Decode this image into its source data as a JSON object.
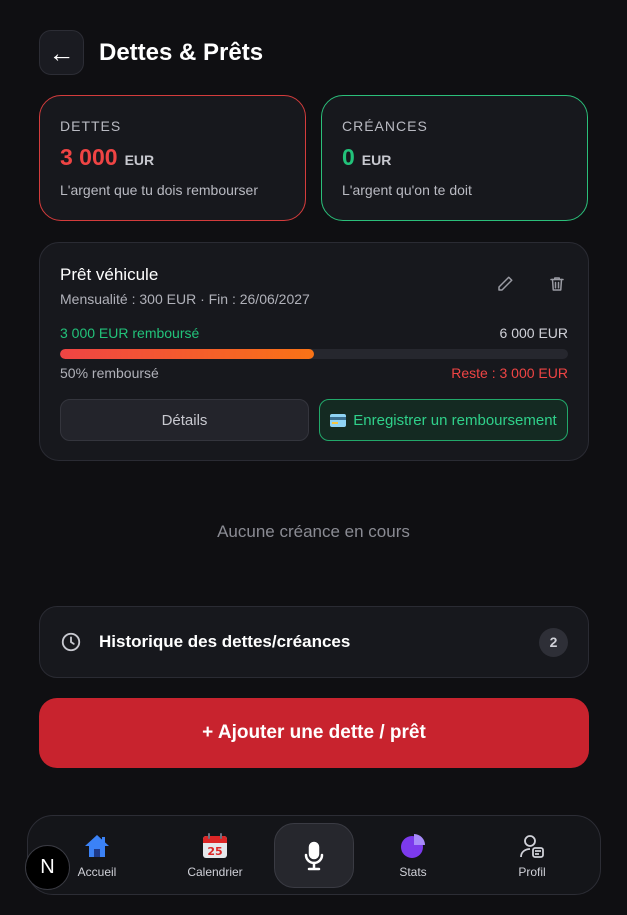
{
  "header": {
    "back_icon": "arrow-left-icon",
    "title": "Dettes & Prêts"
  },
  "summary": {
    "debts": {
      "label": "DETTES",
      "amount": "3 000",
      "currency": "EUR",
      "description": "L'argent que tu dois rembourser",
      "color": "#ef4444"
    },
    "credits": {
      "label": "CRÉANCES",
      "amount": "0",
      "currency": "EUR",
      "description": "L'argent qu'on te doit",
      "color": "#22c27a"
    }
  },
  "loan": {
    "title": "Prêt véhicule",
    "meta": "Mensualité : 300 EUR · Fin : 26/06/2027",
    "repaid_label": "3 000 EUR remboursé",
    "total_label": "6 000 EUR",
    "progress_percent": 50,
    "percent_label": "50% remboursé",
    "remaining_label": "Reste : 3 000 EUR",
    "details_button": "Détails",
    "repay_button": "Enregistrer un remboursement"
  },
  "credits_empty_text": "Aucune créance en cours",
  "history": {
    "label": "Historique des dettes/créances",
    "count": "2"
  },
  "add_button": "+ Ajouter une dette / prêt",
  "nav": {
    "items": [
      {
        "label": "Accueil",
        "icon": "home-icon"
      },
      {
        "label": "Calendrier",
        "icon": "calendar-icon",
        "calendar_day": "25"
      },
      {
        "label": "Stats",
        "icon": "pie-chart-icon"
      },
      {
        "label": "Profil",
        "icon": "profile-icon"
      }
    ],
    "mic_icon": "microphone-icon"
  },
  "badge": {
    "letter": "N"
  }
}
